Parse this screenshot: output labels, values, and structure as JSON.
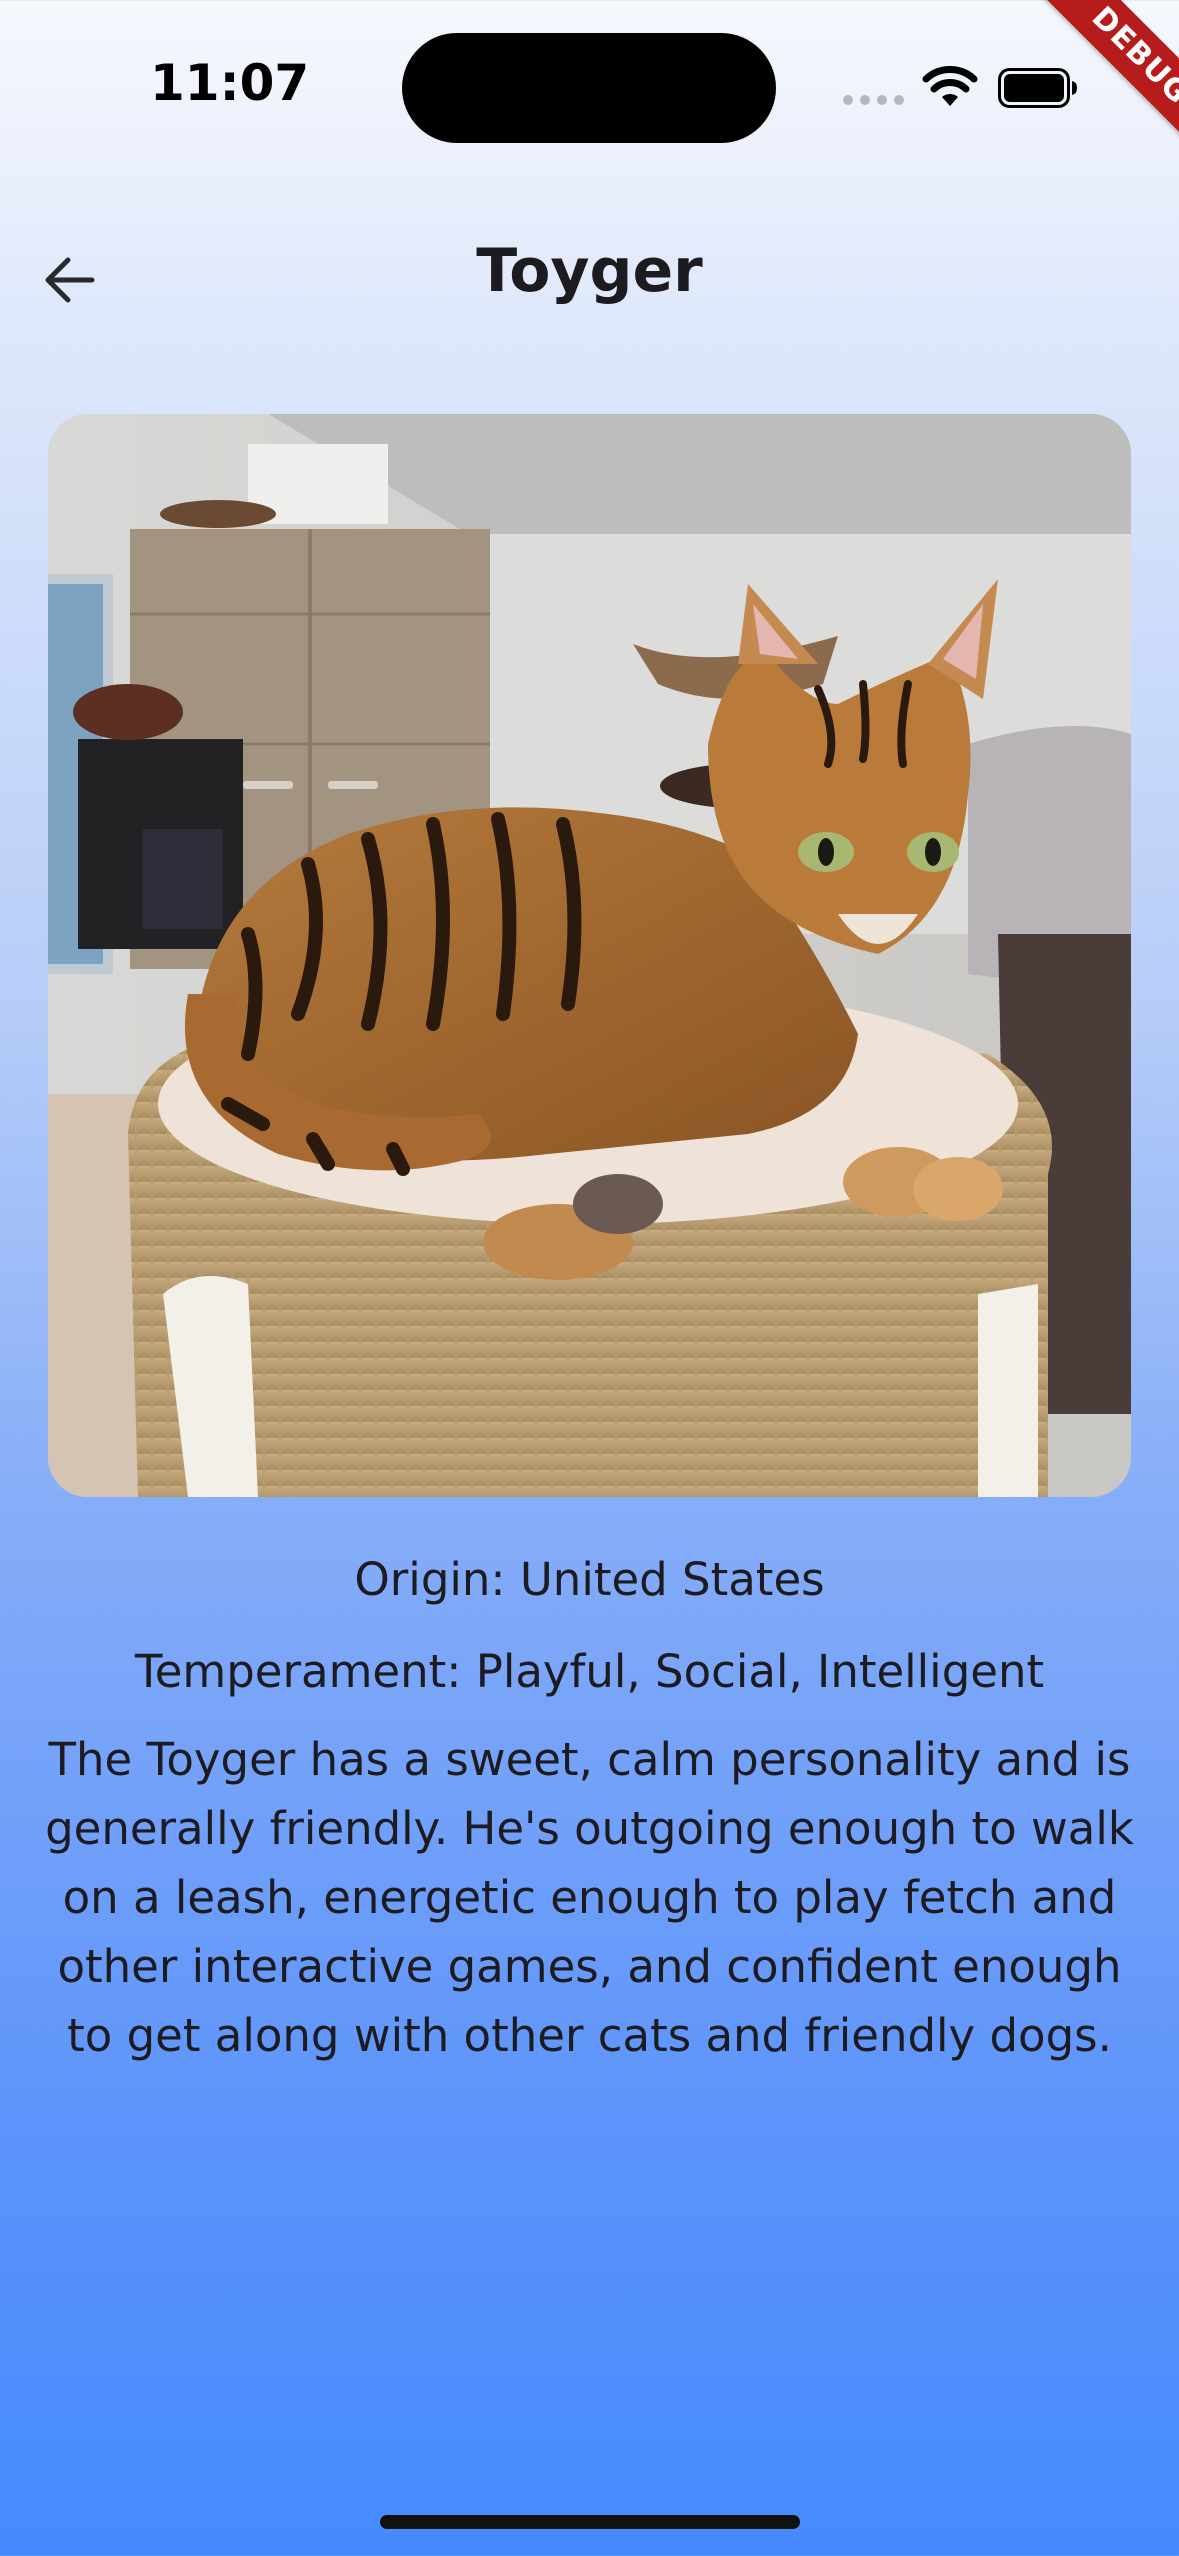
{
  "status_bar": {
    "time": "11:07"
  },
  "debug_banner": "DEBUG",
  "header": {
    "title": "Toyger"
  },
  "breed": {
    "origin": "Origin: United States",
    "temperament": "Temperament: Playful, Social, Intelligent",
    "description": "The Toyger has a sweet, calm personality and is generally friendly. He's outgoing enough to walk on a leash, energetic enough to play fetch and other interactive games, and confident enough to get along with other cats and friendly dogs."
  },
  "icons": {
    "back": "arrow-left-icon",
    "wifi": "wifi-icon",
    "battery": "battery-icon",
    "signal": "cellular-signal-icon"
  },
  "colors": {
    "text": "#1d1b20",
    "background_top": "#f6f8fd",
    "background_bottom": "#458afd",
    "debug_banner": "#b71c1c"
  }
}
